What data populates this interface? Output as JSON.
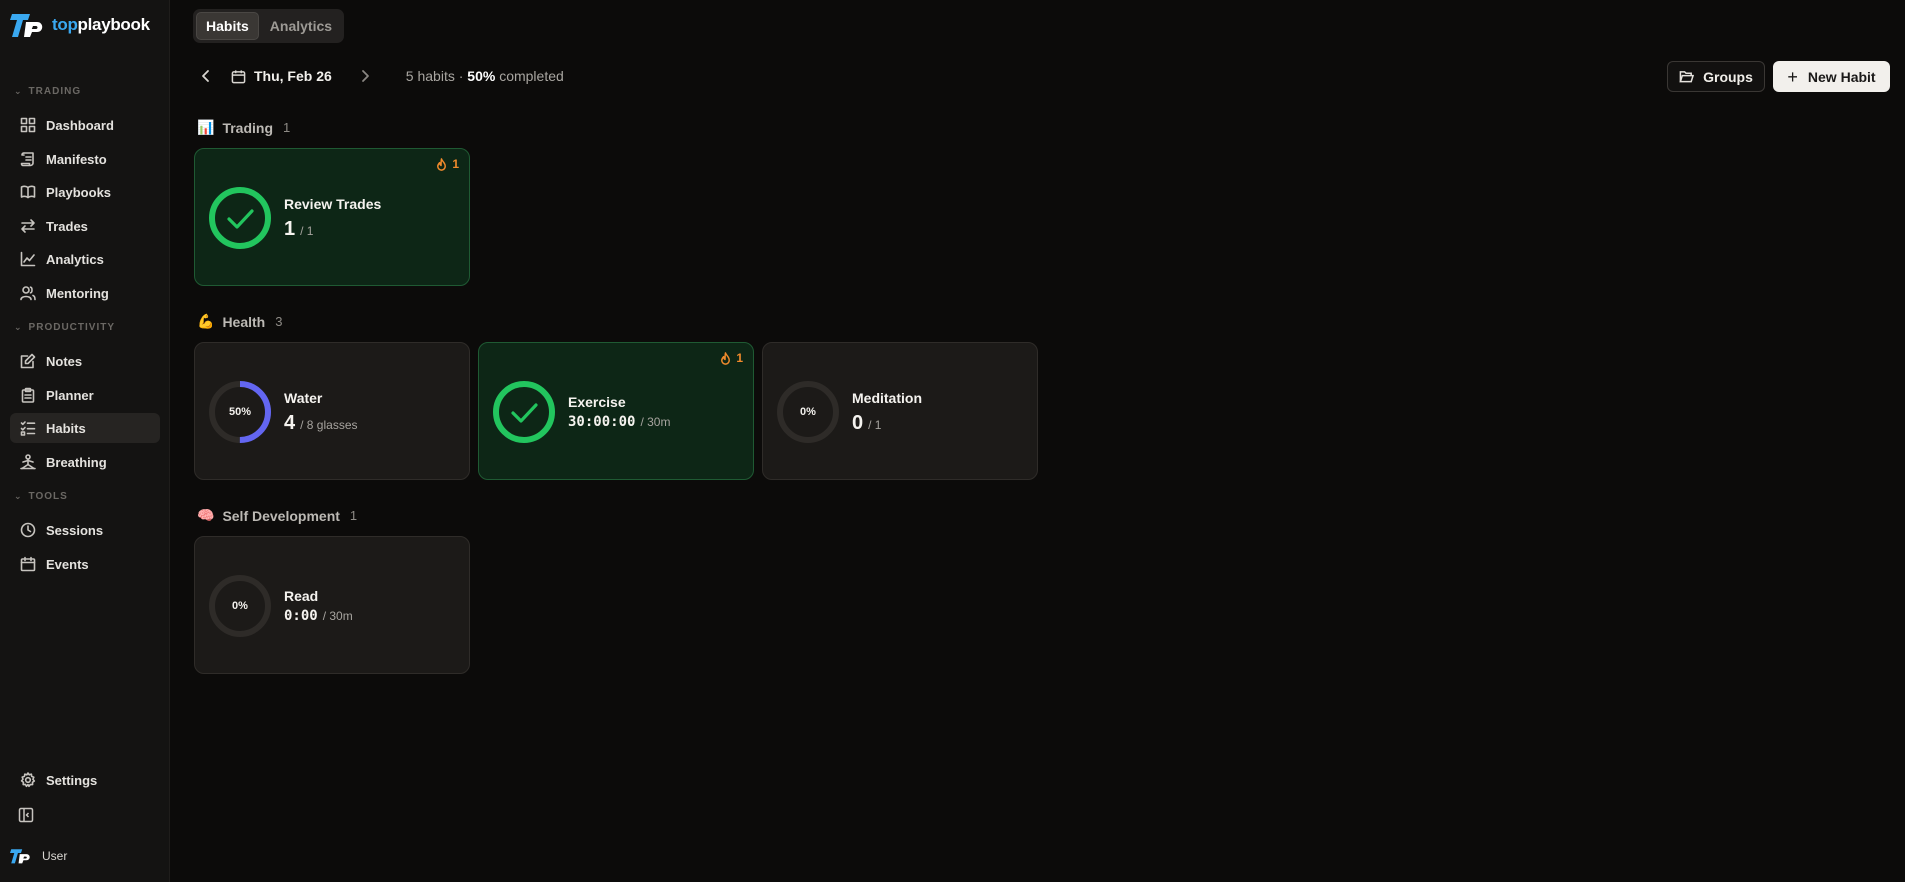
{
  "brand": {
    "name_part1": "top",
    "name_part2": "playbook"
  },
  "sidebar": {
    "sections": [
      {
        "label": "TRADING"
      },
      {
        "label": "PRODUCTIVITY"
      },
      {
        "label": "TOOLS"
      }
    ],
    "items": [
      {
        "label": "Dashboard",
        "icon": "dashboard-icon"
      },
      {
        "label": "Manifesto",
        "icon": "scroll-icon"
      },
      {
        "label": "Playbooks",
        "icon": "book-icon"
      },
      {
        "label": "Trades",
        "icon": "arrows-icon"
      },
      {
        "label": "Analytics",
        "icon": "chart-icon"
      },
      {
        "label": "Mentoring",
        "icon": "users-icon"
      },
      {
        "label": "Notes",
        "icon": "note-icon"
      },
      {
        "label": "Planner",
        "icon": "clipboard-icon"
      },
      {
        "label": "Habits",
        "icon": "list-check-icon",
        "active": true
      },
      {
        "label": "Breathing",
        "icon": "person-icon"
      },
      {
        "label": "Sessions",
        "icon": "clock-icon"
      },
      {
        "label": "Events",
        "icon": "calendar-icon"
      },
      {
        "label": "Settings",
        "icon": "gear-icon"
      }
    ],
    "user_label": "User"
  },
  "header": {
    "tabs": [
      {
        "label": "Habits",
        "active": true
      },
      {
        "label": "Analytics",
        "active": false
      }
    ],
    "date": "Thu, Feb 26",
    "summary_prefix": "5 habits · ",
    "summary_percent": "50%",
    "summary_suffix": " completed",
    "groups_label": "Groups",
    "new_habit_label": "New Habit"
  },
  "groups": [
    {
      "emoji": "📊",
      "name": "Trading",
      "count": "1"
    },
    {
      "emoji": "💪",
      "name": "Health",
      "count": "3"
    },
    {
      "emoji": "🧠",
      "name": "Self Development",
      "count": "1"
    }
  ],
  "habits": [
    {
      "name": "Review Trades",
      "value": "1",
      "target": "/ 1",
      "progress": 1.0,
      "completed": true,
      "streak": "1"
    },
    {
      "name": "Water",
      "value": "4",
      "target": "/ 8 glasses",
      "progress": 0.5,
      "ring_label": "50%",
      "completed": false
    },
    {
      "name": "Exercise",
      "value": "30:00:00",
      "target": "/ 30m",
      "progress": 1.0,
      "completed": true,
      "streak": "1"
    },
    {
      "name": "Meditation",
      "value": "0",
      "target": "/ 1",
      "progress": 0.0,
      "ring_label": "0%",
      "completed": false
    },
    {
      "name": "Read",
      "value": "0:00",
      "target": "/ 30m",
      "progress": 0.0,
      "ring_label": "0%",
      "completed": false
    }
  ],
  "colors": {
    "done": "#22c55e",
    "progress": "#6366f1",
    "track": "#2e2b28",
    "streak": "#f08a2c",
    "brand": "#3aa8f0"
  }
}
